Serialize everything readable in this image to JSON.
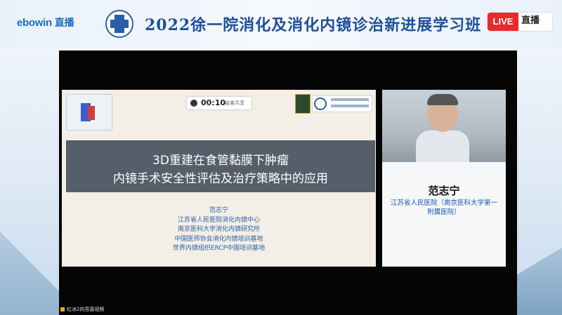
{
  "header": {
    "logo": "ebowin",
    "logo_suffix": "直播",
    "title": "2022徐一院消化及消化内镜诊治新进展学习班",
    "live_tag": "LIVE",
    "live_label": "直播"
  },
  "slide": {
    "timer": "00:10",
    "timer_sub": "结束共享",
    "title_line1": "3D重建在食管黏膜下肿瘤",
    "title_line2": "内镜手术安全性评估及治疗策略中的应用",
    "author": "范志宁",
    "affiliations": [
      "江苏省人民医院消化内镜中心",
      "南京医科大学消化内镜研究所",
      "中国医师协会消化内镜培训基地",
      "世界内镜组织ERCP中国培训基地"
    ]
  },
  "speaker": {
    "name": "范志宁",
    "affiliation": "江苏省人民医院（南京医科大学第一附属医院）"
  },
  "ticker": "红冰2的吾嘉视频",
  "colors": {
    "header_title": "#1e4f98",
    "live_red": "#e52b2b",
    "slide_title_bg": "#555e69",
    "affiliation_blue": "#2a5fa5"
  }
}
